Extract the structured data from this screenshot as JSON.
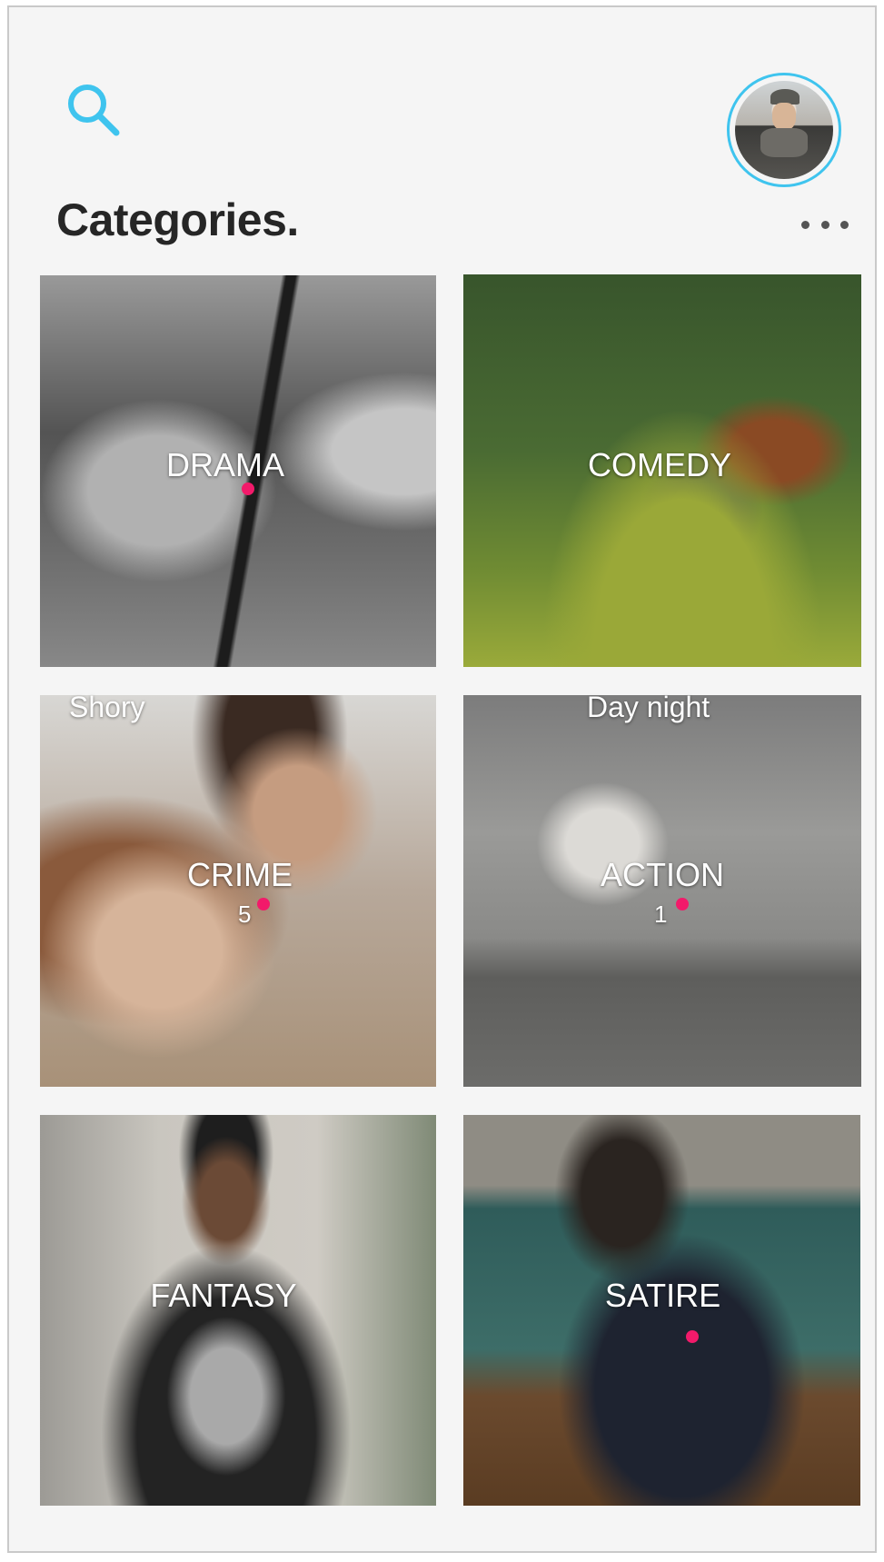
{
  "header": {
    "search_icon": "search-icon",
    "avatar_icon": "profile-avatar",
    "title": "Categories.",
    "more_icon": "more-horizontal-icon"
  },
  "colors": {
    "accent": "#3fc4ee",
    "dot": "#f21a6a",
    "background": "#f5f5f5",
    "title": "#262626"
  },
  "categories": [
    {
      "label": "DRAMA",
      "count": "",
      "has_dot": true,
      "overlay": ""
    },
    {
      "label": "COMEDY",
      "count": "",
      "has_dot": false,
      "overlay": ""
    },
    {
      "label": "CRIME",
      "count": "5",
      "has_dot": true,
      "overlay": "Shory"
    },
    {
      "label": "ACTION",
      "count": "1",
      "has_dot": true,
      "overlay": "Day night"
    },
    {
      "label": "FANTASY",
      "count": "",
      "has_dot": false,
      "overlay": ""
    },
    {
      "label": "SATIRE",
      "count": "",
      "has_dot": true,
      "overlay": ""
    }
  ]
}
